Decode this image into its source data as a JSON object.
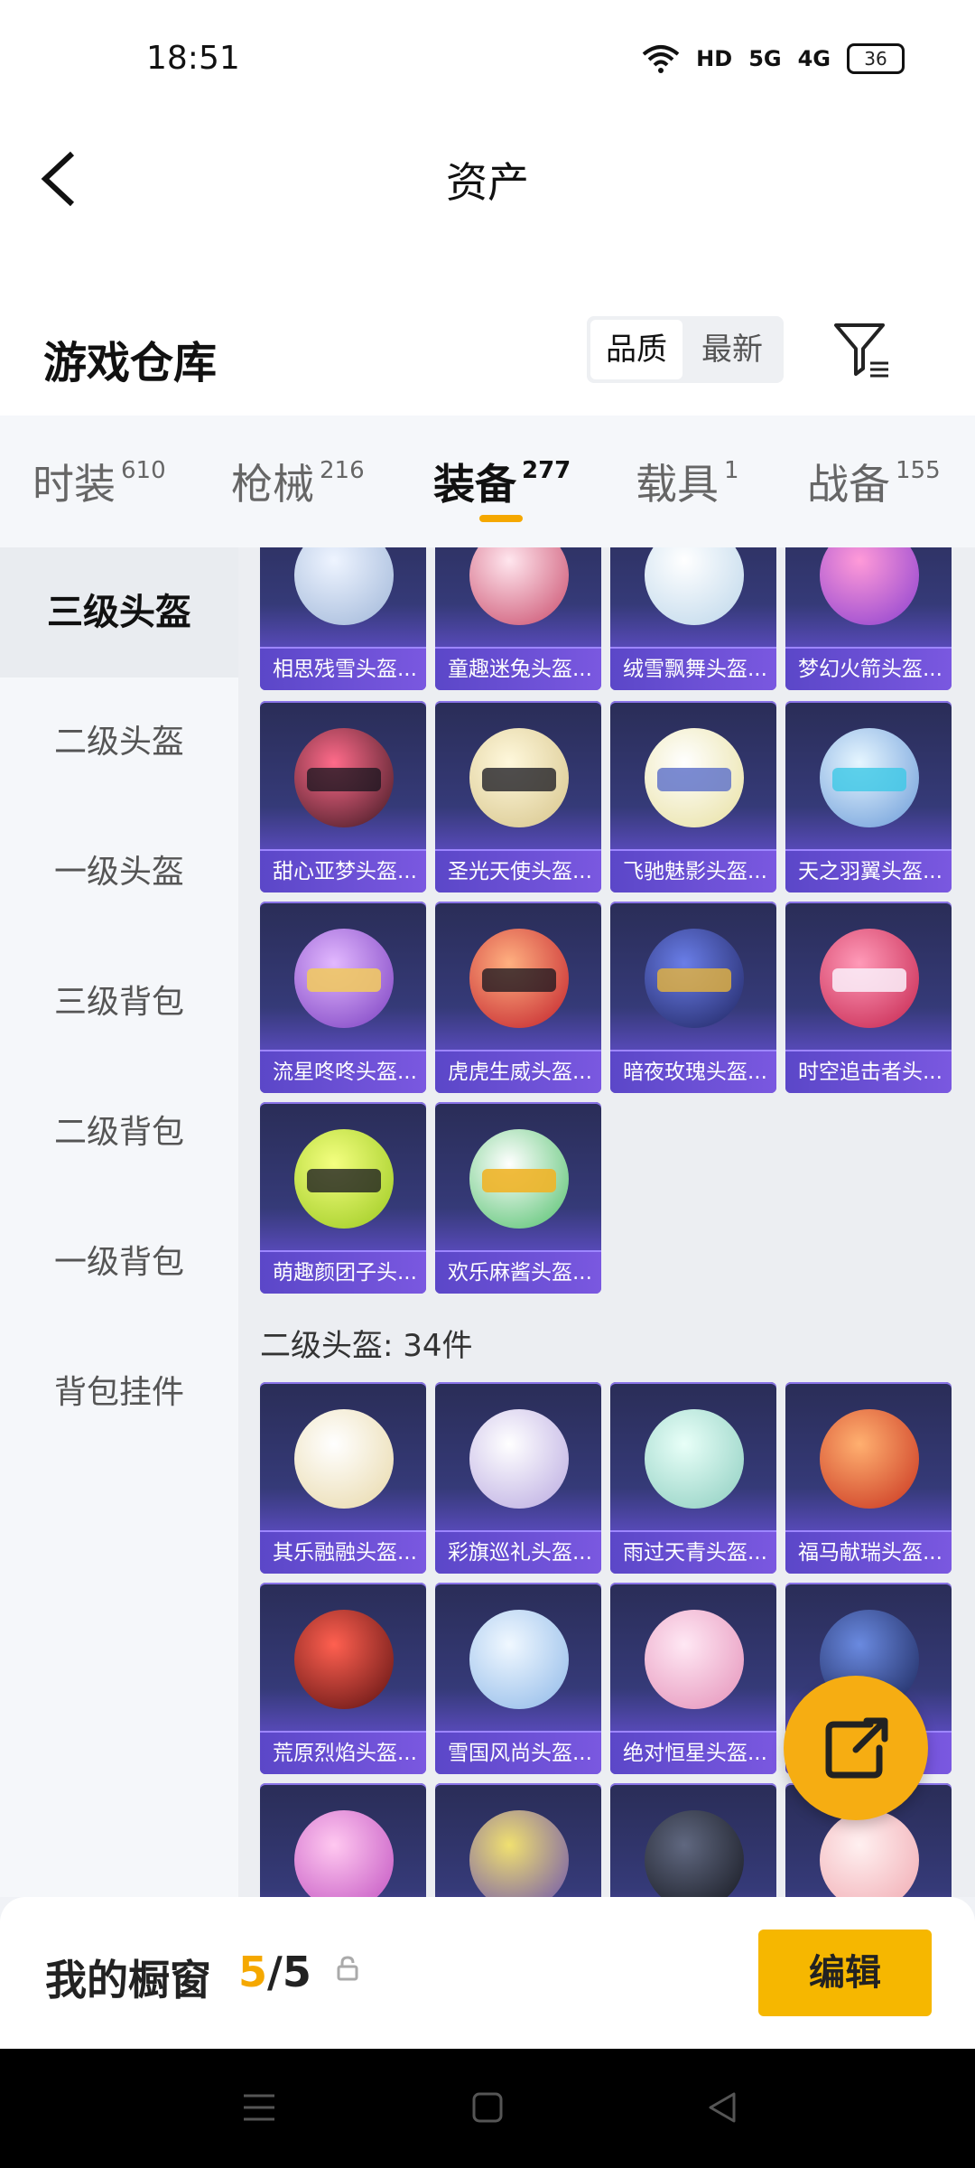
{
  "status": {
    "time": "18:51",
    "hd": "HD",
    "net1": "5G",
    "net2": "4G",
    "battery": "36"
  },
  "header": {
    "title": "资产"
  },
  "warehouse": {
    "title": "游戏仓库",
    "sort": [
      "品质",
      "最新"
    ]
  },
  "tabs": [
    {
      "label": "时装",
      "count": "610"
    },
    {
      "label": "枪械",
      "count": "216"
    },
    {
      "label": "装备",
      "count": "277"
    },
    {
      "label": "载具",
      "count": "1"
    },
    {
      "label": "战备",
      "count": "155"
    }
  ],
  "sidebar": [
    "三级头盔",
    "二级头盔",
    "一级头盔",
    "三级背包",
    "二级背包",
    "一级背包",
    "背包挂件"
  ],
  "section1": {
    "items": [
      "相思残雪头盔...",
      "童趣迷兔头盔...",
      "绒雪飘舞头盔...",
      "梦幻火箭头盔...",
      "甜心亚梦头盔...",
      "圣光天使头盔...",
      "飞驰魅影头盔...",
      "天之羽翼头盔...",
      "流星咚咚头盔...",
      "虎虎生威头盔...",
      "暗夜玫瑰头盔...",
      "时空追击者头...",
      "萌趣颜团子头...",
      "欢乐麻酱头盔..."
    ]
  },
  "section2": {
    "title": "二级头盔: 34件",
    "items": [
      "其乐融融头盔...",
      "彩旗巡礼头盔...",
      "雨过天青头盔...",
      "福马献瑞头盔...",
      "荒原烈焰头盔...",
      "雪国风尚头盔...",
      "绝对恒星头盔...",
      "",
      "",
      "",
      "",
      ""
    ]
  },
  "bottom": {
    "label": "我的橱窗",
    "count_current": "5",
    "count_sep": "/",
    "count_total": "5",
    "edit": "编辑"
  },
  "colors": {
    "accent": "#f5a800",
    "card_purple": "#5b47c8"
  }
}
